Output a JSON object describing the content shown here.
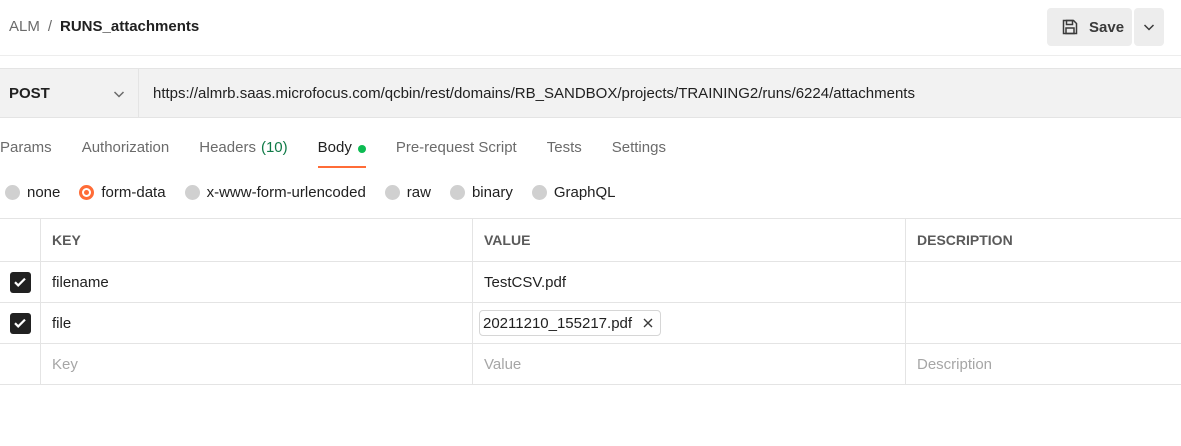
{
  "breadcrumb": {
    "parent": "ALM",
    "separator": "/",
    "current": "RUNS_attachments"
  },
  "save": {
    "label": "Save"
  },
  "request": {
    "method": "POST",
    "url": "https://almrb.saas.microfocus.com/qcbin/rest/domains/RB_SANDBOX/projects/TRAINING2/runs/6224/attachments"
  },
  "tabs": {
    "params": "Params",
    "authorization": "Authorization",
    "headers": "Headers",
    "headers_count": "(10)",
    "body": "Body",
    "prerequest": "Pre-request Script",
    "tests": "Tests",
    "settings": "Settings"
  },
  "body_types": {
    "none": "none",
    "form_data": "form-data",
    "urlencoded": "x-www-form-urlencoded",
    "raw": "raw",
    "binary": "binary",
    "graphql": "GraphQL",
    "selected": "form-data"
  },
  "table": {
    "headers": {
      "key": "KEY",
      "value": "VALUE",
      "description": "DESCRIPTION"
    },
    "rows": [
      {
        "key": "filename",
        "value": "TestCSV.pdf",
        "description": ""
      },
      {
        "key": "file",
        "value": "20211210_155217.pdf",
        "description": ""
      }
    ],
    "placeholders": {
      "key": "Key",
      "value": "Value",
      "description": "Description"
    }
  },
  "colors": {
    "accent": "#ff6c37",
    "body_dot": "#0cbb52",
    "headers_count": "#0f7a47"
  },
  "icons": {
    "save": "save-icon",
    "caret": "chevron-down-icon",
    "check": "check-icon",
    "remove": "close-icon"
  }
}
